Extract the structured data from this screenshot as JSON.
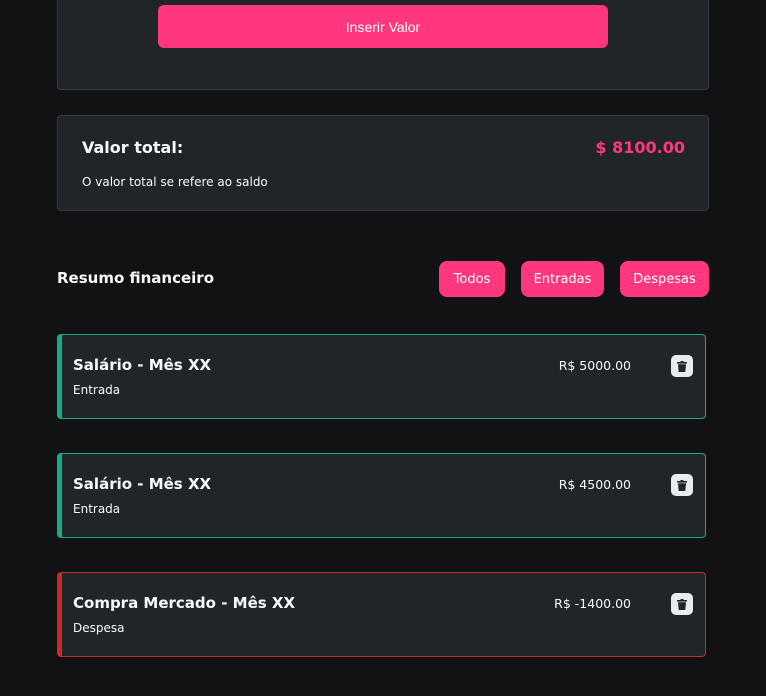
{
  "form": {
    "insert_label": "Inserir Valor"
  },
  "total": {
    "label": "Valor total:",
    "value": "$ 8100.00",
    "note": "O valor total se refere ao saldo"
  },
  "summary": {
    "title": "Resumo financeiro",
    "filters": [
      "Todos",
      "Entradas",
      "Despesas"
    ]
  },
  "entries": [
    {
      "title": "Salário - Mês XX",
      "type": "Entrada",
      "amount": "R$ 5000.00",
      "icon": "trash-icon"
    },
    {
      "title": "Salário - Mês XX",
      "type": "Entrada",
      "amount": "R$ 4500.00",
      "icon": "trash-icon"
    },
    {
      "title": "Compra Mercado - Mês XX",
      "type": "Despesa",
      "amount": "R$ -1400.00",
      "icon": "trash-icon"
    }
  ],
  "colors": {
    "accent": "#ff377f",
    "income": "#1aa987",
    "expense": "#c92a2a",
    "card": "#212529",
    "background": "#121214"
  }
}
